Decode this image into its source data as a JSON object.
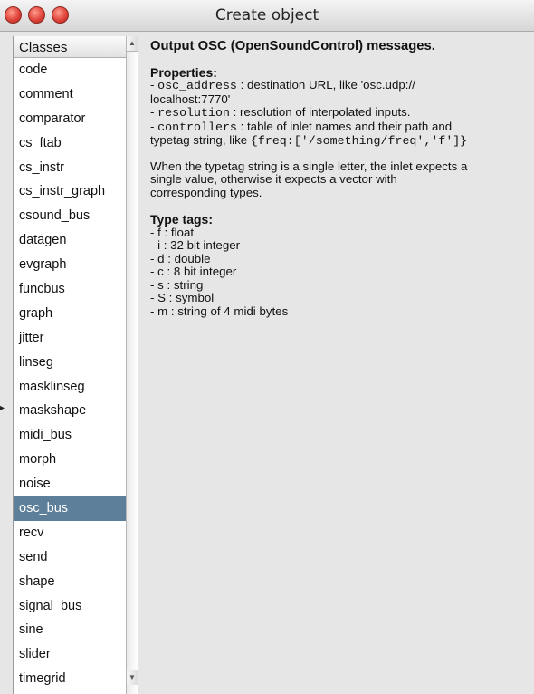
{
  "window": {
    "title": "Create object"
  },
  "classes": {
    "header": "Classes",
    "items": [
      "code",
      "comment",
      "comparator",
      "cs_ftab",
      "cs_instr",
      "cs_instr_graph",
      "csound_bus",
      "datagen",
      "evgraph",
      "funcbus",
      "graph",
      "jitter",
      "linseg",
      "masklinseg",
      "maskshape",
      "midi_bus",
      "morph",
      "noise",
      "osc_bus",
      "recv",
      "send",
      "shape",
      "signal_bus",
      "sine",
      "slider",
      "timegrid"
    ],
    "selected": "osc_bus"
  },
  "detail": {
    "heading": "Output OSC (OpenSoundControl) messages.",
    "properties_heading": "Properties:",
    "prop1_dash": "- ",
    "prop1_name": "osc_address",
    "prop1_text": " : destination URL, like 'osc.udp://",
    "prop1_cont": "localhost:7770'",
    "prop2_dash": "- ",
    "prop2_name": "resolution",
    "prop2_text": " : resolution of interpolated inputs.",
    "prop3_dash": "- ",
    "prop3_name": "controllers",
    "prop3_text": " : table of inlet names and their path and",
    "prop3_cont": "typetag string, like ",
    "prop3_code": "{freq:['/something/freq','f']}",
    "para_line1": "When the typetag string is a single letter, the inlet expects a",
    "para_line2": "single value, otherwise it expects a vector with",
    "para_line3": "corresponding types.",
    "typetags_heading": "Type tags:",
    "typetags": [
      "- f : float",
      "- i : 32 bit integer",
      "- d : double",
      "- c : 8 bit integer",
      "- s : string",
      "- S : symbol",
      "- m : string of 4 midi bytes"
    ]
  },
  "colors": {
    "selection": "#5e7f99",
    "close_button": "#e0443a"
  },
  "icons": [
    "close-icon",
    "minimize-icon",
    "zoom-icon",
    "scroll-up-arrow-icon",
    "scroll-down-arrow-icon"
  ]
}
